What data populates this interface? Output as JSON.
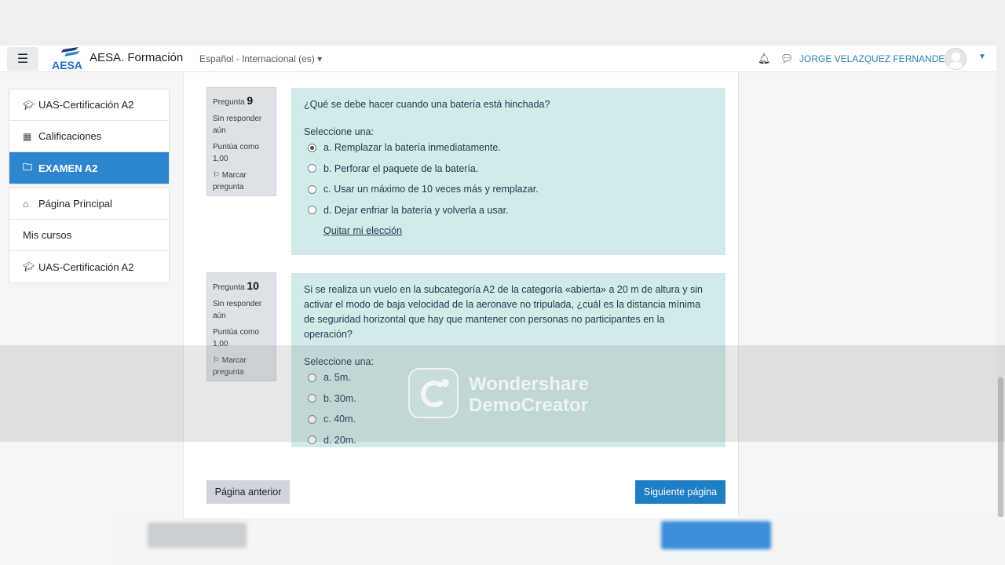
{
  "navbar": {
    "brand": "AESA. Formación",
    "language": "Español - Internacional (es)",
    "user_name": "JORGE VELAZQUEZ FERNANDEZ"
  },
  "drawer": {
    "group1": [
      {
        "label": "UAS-Certificación A2",
        "icon": "graduation-cap-icon"
      },
      {
        "label": "Calificaciones",
        "icon": "table-icon"
      },
      {
        "label": "EXAMEN A2",
        "icon": "folder-icon",
        "active": true
      }
    ],
    "group2": [
      {
        "label": "Página Principal",
        "icon": "home-icon"
      },
      {
        "label": "Mis cursos",
        "icon": ""
      },
      {
        "label": "UAS-Certificación A2",
        "icon": "graduation-cap-icon"
      }
    ]
  },
  "questions": [
    {
      "label": "Pregunta",
      "number": "9",
      "status": "Sin responder aún",
      "score": "Puntúa como 1,00",
      "flag": "Marcar pregunta",
      "text": "¿Qué se debe hacer cuando una batería está hinchada?",
      "select_label": "Seleccione una:",
      "options": [
        "a. Remplazar la batería inmediatamente.",
        "b. Perforar el paquete de la batería.",
        "c. Usar un máximo de 10 veces más y remplazar.",
        "d. Dejar enfriar la batería y volverla a usar."
      ],
      "selected_index": 0,
      "clear_choice": "Quitar mi elección"
    },
    {
      "label": "Pregunta",
      "number": "10",
      "status": "Sin responder aún",
      "score": "Puntúa como 1,00",
      "flag": "Marcar pregunta",
      "text": "Si se realiza un vuelo en la subcategoría A2 de la categoría «abierta» a 20 m de altura y sin activar el modo de baja velocidad de la aeronave no tripulada, ¿cuál es la distancia mínima de seguridad horizontal que hay que mantener con personas no participantes en la operación?",
      "select_label": "Seleccione una:",
      "options": [
        "a. 5m.",
        "b. 30m.",
        "c. 40m.",
        "d. 20m."
      ],
      "selected_index": -1
    }
  ],
  "buttons": {
    "prev": "Página anterior",
    "next": "Siguiente página"
  },
  "watermark": {
    "line1": "Wondershare",
    "line2": "DemoCreator"
  },
  "colors": {
    "primary": "#1f7dc4",
    "active_nav": "#2e86cf",
    "answer_box": "#d0ebe9",
    "info_box": "#dee2e6"
  }
}
